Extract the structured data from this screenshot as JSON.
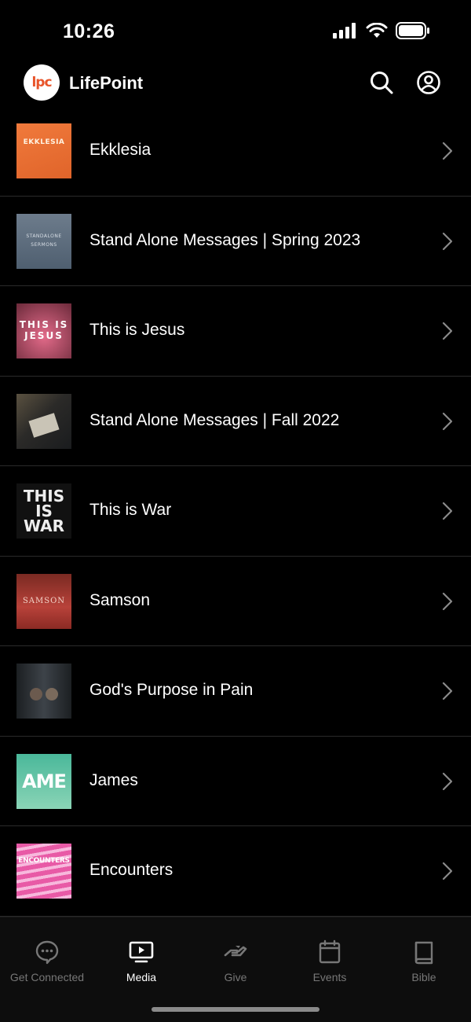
{
  "status": {
    "time": "10:26"
  },
  "header": {
    "logo_text": "lpc",
    "title": "LifePoint"
  },
  "list": [
    {
      "title": "Ekklesia",
      "thumb_text": "EKKLESIA"
    },
    {
      "title": "Stand Alone Messages | Spring 2023",
      "thumb_text": "STANDALONE SERMONS"
    },
    {
      "title": "This is Jesus",
      "thumb_text": "THIS IS JESUS"
    },
    {
      "title": "Stand Alone Messages | Fall 2022",
      "thumb_text": ""
    },
    {
      "title": "This is War",
      "thumb_text": "THIS IS WAR"
    },
    {
      "title": "Samson",
      "thumb_text": "SAMSON"
    },
    {
      "title": "God's Purpose in Pain",
      "thumb_text": ""
    },
    {
      "title": "James",
      "thumb_text": "AME"
    },
    {
      "title": "Encounters",
      "thumb_text": "ENCOUNTERS"
    }
  ],
  "tabs": [
    {
      "label": "Get Connected",
      "icon": "chat-bubble-icon",
      "active": false
    },
    {
      "label": "Media",
      "icon": "media-play-icon",
      "active": true
    },
    {
      "label": "Give",
      "icon": "give-hand-icon",
      "active": false
    },
    {
      "label": "Events",
      "icon": "calendar-icon",
      "active": false
    },
    {
      "label": "Bible",
      "icon": "book-icon",
      "active": false
    }
  ],
  "colors": {
    "background": "#000000",
    "divider": "#2a2a2a",
    "inactive_tab": "#777777",
    "brand": "#e8542a"
  }
}
